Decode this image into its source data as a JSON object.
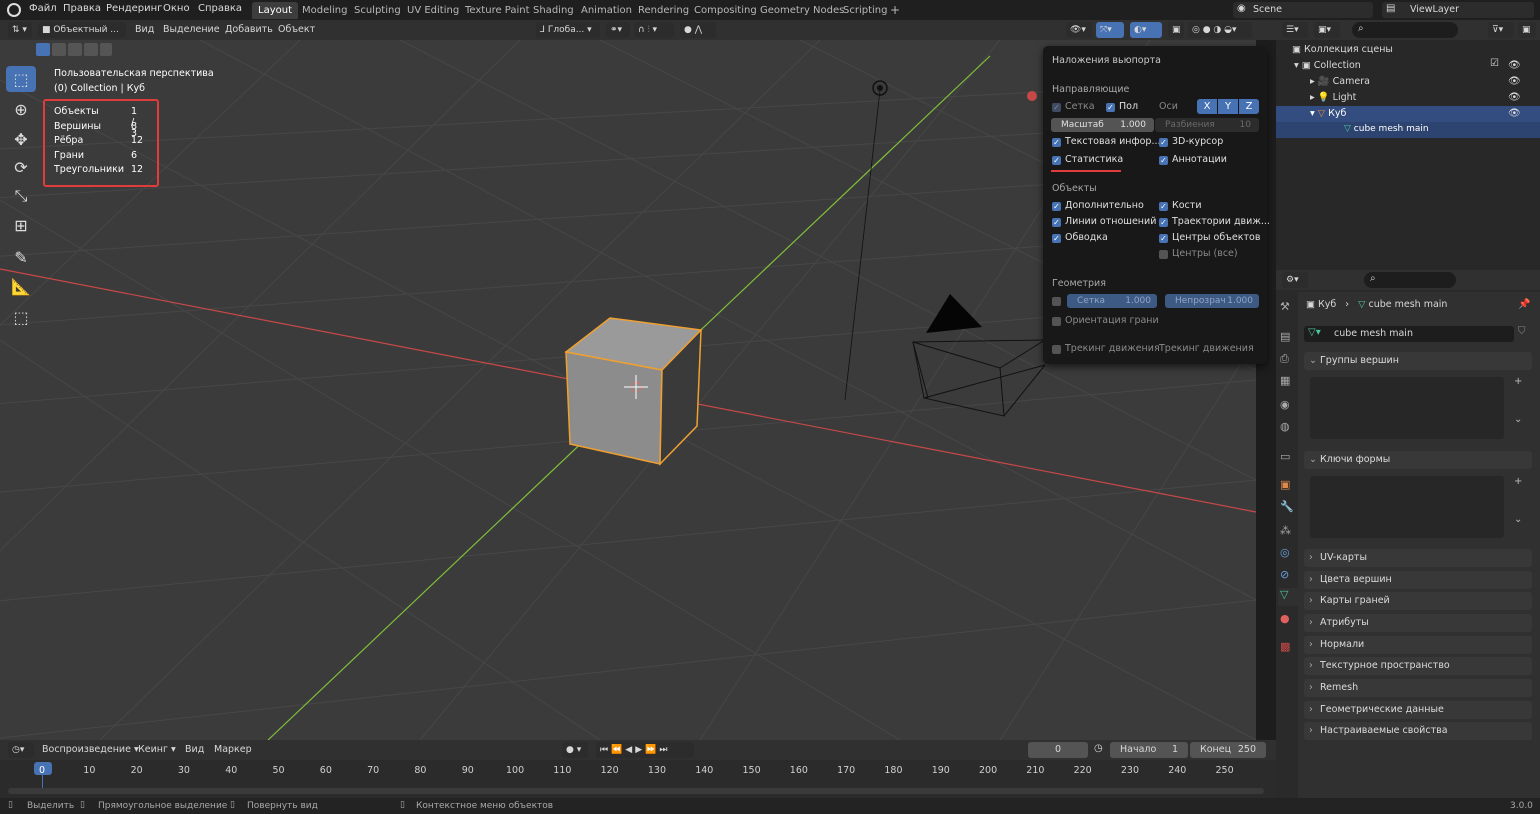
{
  "menu": [
    "Файл",
    "Правка",
    "Рендеринг",
    "Окно",
    "Справка"
  ],
  "workspaces": [
    "Layout",
    "Modeling",
    "Sculpting",
    "UV Editing",
    "Texture Paint",
    "Shading",
    "Animation",
    "Rendering",
    "Compositing",
    "Geometry Nodes",
    "Scripting"
  ],
  "active_workspace": "Layout",
  "plus": "+",
  "scene_name": "Scene",
  "view_layer": "ViewLayer",
  "header": {
    "mode": "Объектный ...",
    "view": "Вид",
    "select": "Выделение",
    "add": "Добавить",
    "object": "Объект",
    "orientation": "Глоба..."
  },
  "viewport": {
    "perspective": "Пользовательская перспектива",
    "collection": "(0) Collection | Куб"
  },
  "stats": [
    {
      "label": "Объекты",
      "value": "1 / 3"
    },
    {
      "label": "Вершины",
      "value": "8"
    },
    {
      "label": "Рёбра",
      "value": "12"
    },
    {
      "label": "Грани",
      "value": "6"
    },
    {
      "label": "Треугольники",
      "value": "12"
    }
  ],
  "overlays": {
    "title": "Наложения вьюпорта",
    "guides": "Направляющие",
    "grid": "Сетка",
    "floor": "Пол",
    "axes": "Оси",
    "axis_x": "X",
    "axis_y": "Y",
    "axis_z": "Z",
    "scale_label": "Масштаб",
    "scale_value": "1.000",
    "subdiv_label": "Разбиения",
    "subdiv_value": "10",
    "text_info": "Текстовая инфор...",
    "cursor3d": "3D-курсор",
    "statistics": "Статистика",
    "annotations": "Аннотации",
    "objects": "Объекты",
    "extras": "Дополнительно",
    "bones": "Кости",
    "relations": "Линии отношений",
    "motion_paths": "Траектории движ...",
    "outline": "Обводка",
    "origins": "Центры объектов",
    "origins_all": "Центры (все)",
    "geometry": "Геометрия",
    "wireframe_label": "Сетка",
    "wireframe_value": "1.000",
    "opacity_label": "Непрозрач",
    "opacity_value": "1.000",
    "face_orient": "Ориентация грани",
    "motion_tracking": "Трекинг движения",
    "motion_tracking2": "Трекинг движения"
  },
  "outliner": {
    "scene_collection": "Коллекция сцены",
    "items": [
      {
        "name": "Collection"
      },
      {
        "name": "Camera"
      },
      {
        "name": "Light"
      },
      {
        "name": "Куб"
      },
      {
        "name": "cube mesh main"
      }
    ]
  },
  "properties": {
    "breadcrumb_obj": "Куб",
    "breadcrumb_mesh": "cube mesh main",
    "mesh_name": "cube mesh main",
    "panels": [
      "Группы вершин",
      "Ключи формы",
      "UV-карты",
      "Цвета вершин",
      "Карты граней",
      "Атрибуты",
      "Нормали",
      "Текстурное пространство",
      "Remesh",
      "Геометрические данные",
      "Настраиваемые свойства"
    ]
  },
  "timeline": {
    "playback": "Воспроизведение",
    "keying": "Кеинг",
    "view": "Вид",
    "marker": "Маркер",
    "current_frame": "0",
    "start_label": "Начало",
    "start_value": "1",
    "end_label": "Конец",
    "end_value": "250",
    "ticks": [
      "0",
      "10",
      "20",
      "30",
      "40",
      "50",
      "60",
      "70",
      "80",
      "90",
      "100",
      "110",
      "120",
      "130",
      "140",
      "150",
      "160",
      "170",
      "180",
      "190",
      "200",
      "210",
      "220",
      "230",
      "240",
      "250"
    ]
  },
  "status": {
    "select": "Выделить",
    "box_select": "Прямоугольное выделение",
    "rotate_view": "Повернуть вид",
    "context_menu": "Контекстное меню объектов",
    "version": "3.0.0"
  },
  "colors": {
    "accent": "#4772b3",
    "highlight_red": "#e03c3c",
    "selection_orange": "#f0a030",
    "x_axis": "#c84848",
    "y_axis": "#7fbf3a"
  }
}
